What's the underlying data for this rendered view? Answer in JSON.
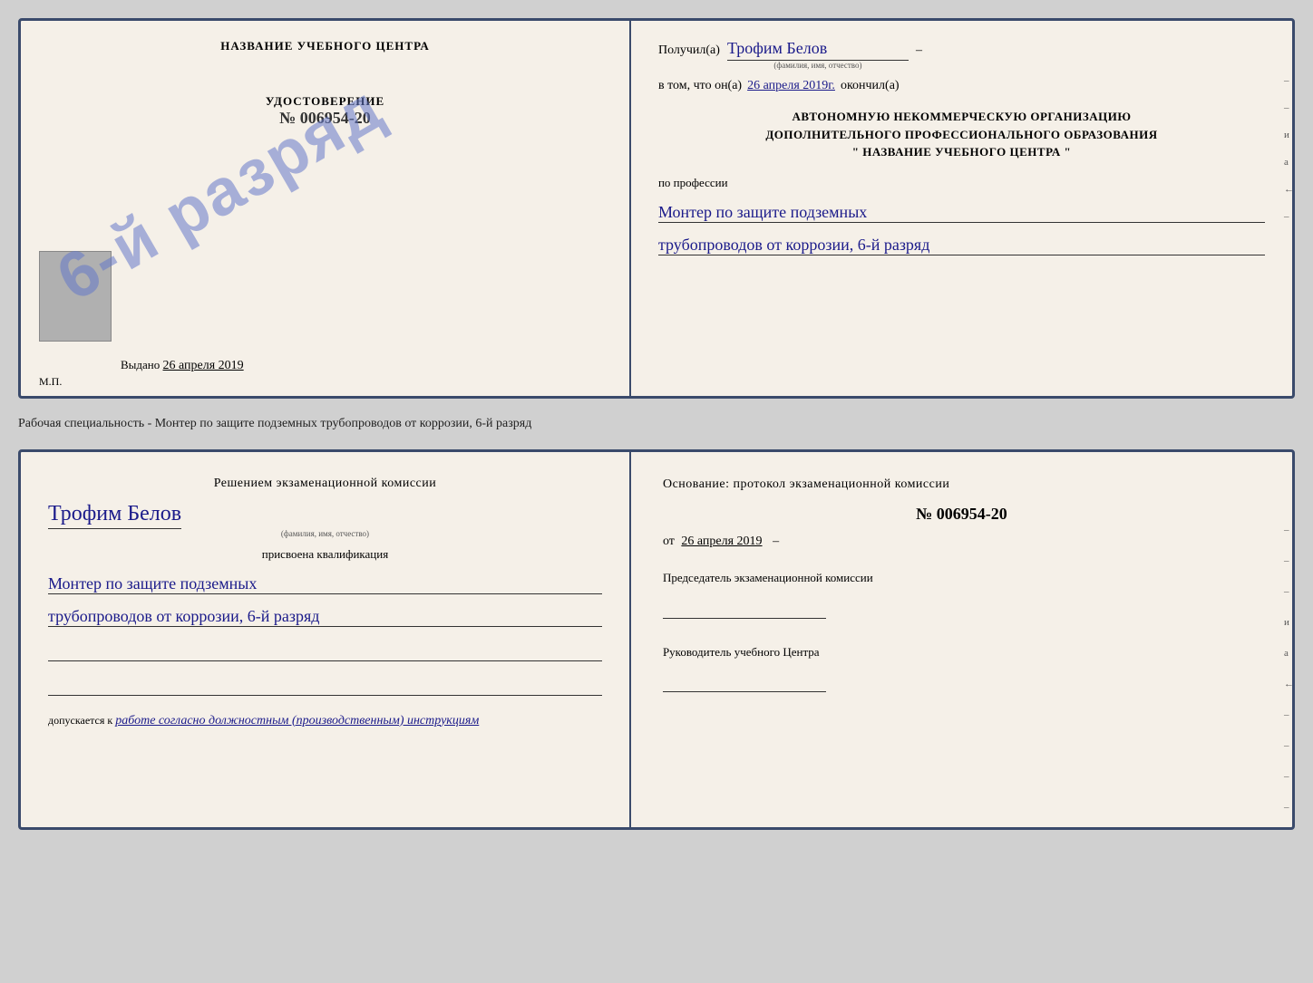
{
  "top_doc": {
    "left": {
      "center_title": "НАЗВАНИЕ УЧЕБНОГО ЦЕНТРА",
      "udostoverenie_label": "УДОСТОВЕРЕНИЕ",
      "doc_number": "№ 006954-20",
      "stamp_text": "6-й разряд",
      "vydano_label": "Выдано",
      "vydano_date": "26 апреля 2019",
      "mp_label": "М.П."
    },
    "right": {
      "received_prefix": "Получил(а)",
      "received_name": "Трофим Белов",
      "received_hint": "(фамилия, имя, отчество)",
      "date_prefix": "в том, что он(а)",
      "date_value": "26 апреля 2019г.",
      "date_suffix": "окончил(а)",
      "org_line1": "АВТОНОМНУЮ НЕКОММЕРЧЕСКУЮ ОРГАНИЗАЦИЮ",
      "org_line2": "ДОПОЛНИТЕЛЬНОГО ПРОФЕССИОНАЛЬНОГО ОБРАЗОВАНИЯ",
      "org_line3": "\" НАЗВАНИЕ УЧЕБНОГО ЦЕНТРА \"",
      "profession_label": "по профессии",
      "profession_line1": "Монтер по защите подземных",
      "profession_line2": "трубопроводов от коррозии, 6-й разряд",
      "side_marks": [
        "–",
        "–",
        "и",
        "а",
        "←",
        "–"
      ]
    }
  },
  "specialty_text": "Рабочая специальность - Монтер по защите подземных трубопроводов от коррозии, 6-й разряд",
  "bottom_doc": {
    "left": {
      "decision_text": "Решением экзаменационной комиссии",
      "person_name": "Трофим Белов",
      "person_hint": "(фамилия, имя, отчество)",
      "qualification_label": "присвоена квалификация",
      "qualification_line1": "Монтер по защите подземных",
      "qualification_line2": "трубопроводов от коррозии, 6-й разряд",
      "allows_prefix": "допускается к",
      "allows_text": "работе согласно должностным (производственным) инструкциям"
    },
    "right": {
      "osnov_text": "Основание: протокол экзаменационной комиссии",
      "protocol_number": "№ 006954-20",
      "date_prefix": "от",
      "date_value": "26 апреля 2019",
      "chairman_label": "Председатель экзаменационной комиссии",
      "director_label": "Руководитель учебного Центра",
      "side_marks": [
        "–",
        "–",
        "–",
        "и",
        "а",
        "←",
        "–",
        "–",
        "–",
        "–"
      ]
    }
  }
}
